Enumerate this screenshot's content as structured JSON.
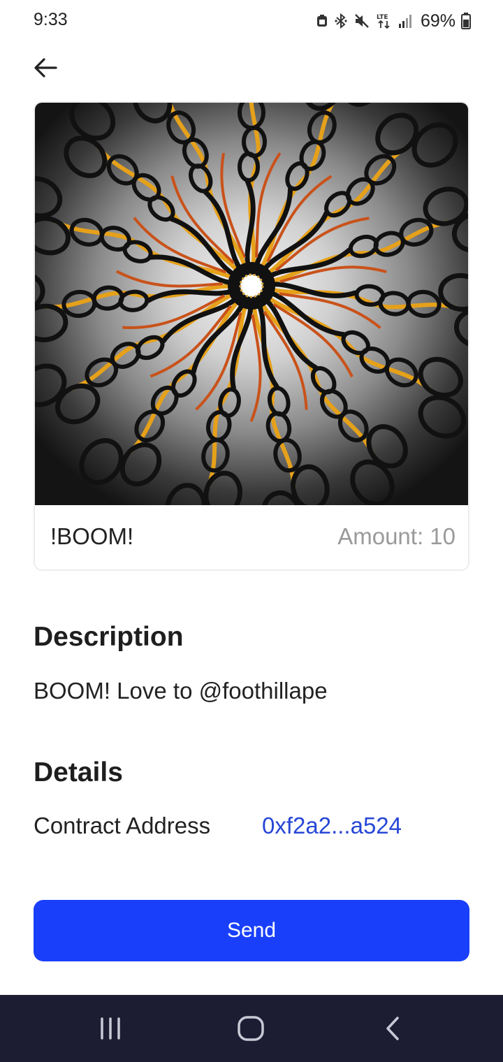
{
  "status_bar": {
    "time": "9:33",
    "battery_percent": "69%",
    "icons": [
      "alarm-icon",
      "bluetooth-icon",
      "mute-icon",
      "lte-icon",
      "signal-icon",
      "battery-icon"
    ]
  },
  "header": {
    "back_icon": "arrow-left-icon"
  },
  "nft": {
    "name": "!BOOM!",
    "amount": "Amount: 10"
  },
  "description": {
    "title": "Description",
    "text": "BOOM! Love to @foothillape"
  },
  "details": {
    "title": "Details",
    "contract_label": "Contract Address",
    "contract_value": "0xf2a2...a524"
  },
  "actions": {
    "send_label": "Send"
  },
  "colors": {
    "accent": "#1a3ffb",
    "link": "#2747d6",
    "nav_bar": "#1c1d33",
    "muted_text": "#9a9a9a"
  },
  "nav": {
    "icons": [
      "recent-apps-icon",
      "home-icon",
      "back-icon"
    ]
  }
}
